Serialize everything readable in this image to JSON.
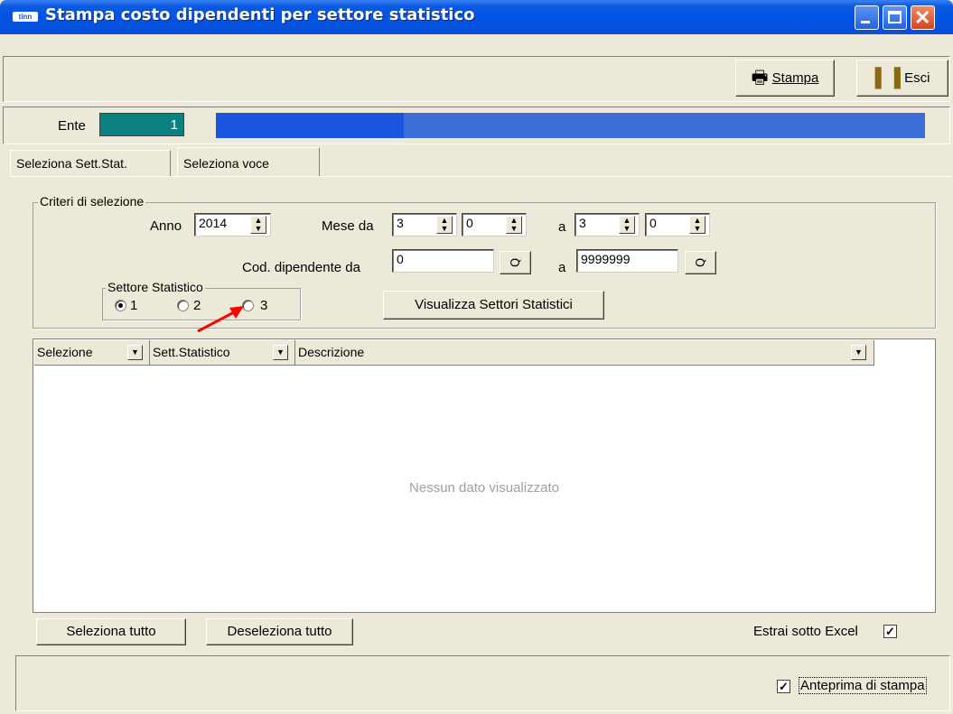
{
  "window": {
    "title": "Stampa costo dipendenti per settore statistico",
    "app_icon_text": "ᵘᵘᵐ"
  },
  "toolbar": {
    "print_label": "Stampa",
    "exit_label": "Esci"
  },
  "ente": {
    "label": "Ente",
    "value": "1"
  },
  "tabs": [
    {
      "label": "Seleziona Sett.Stat."
    },
    {
      "label": "Seleziona voce"
    }
  ],
  "criteria": {
    "legend": "Criteri di selezione",
    "anno_label": "Anno",
    "anno_value": "2014",
    "mese_da_label": "Mese da",
    "mese_da_1": "3",
    "mese_da_2": "0",
    "a_label": "a",
    "mese_a_1": "3",
    "mese_a_2": "0",
    "cod_dip_label": "Cod. dipendente da",
    "cod_dip_da": "0",
    "cod_dip_a": "9999999",
    "settore_legend": "Settore Statistico",
    "settore_options": [
      "1",
      "2",
      "3"
    ],
    "settore_selected": "1",
    "visualizza_button": "Visualizza Settori Statistici"
  },
  "table": {
    "columns": [
      "Selezione",
      "Sett.Statistico",
      "Descrizione"
    ],
    "empty_message": "Nessun dato visualizzato"
  },
  "bottom": {
    "select_all": "Seleziona tutto",
    "deselect_all": "Deseleziona tutto",
    "excel_label": "Estrai sotto Excel",
    "excel_checked": true,
    "preview_label": "Anteprima di stampa",
    "preview_checked": true
  },
  "colors": {
    "titlebar": "#0054e3",
    "ente_value_bg": "#0a8080",
    "ente_desc_bar": "#3c6fd6",
    "annotation_arrow": "#ff0000"
  }
}
